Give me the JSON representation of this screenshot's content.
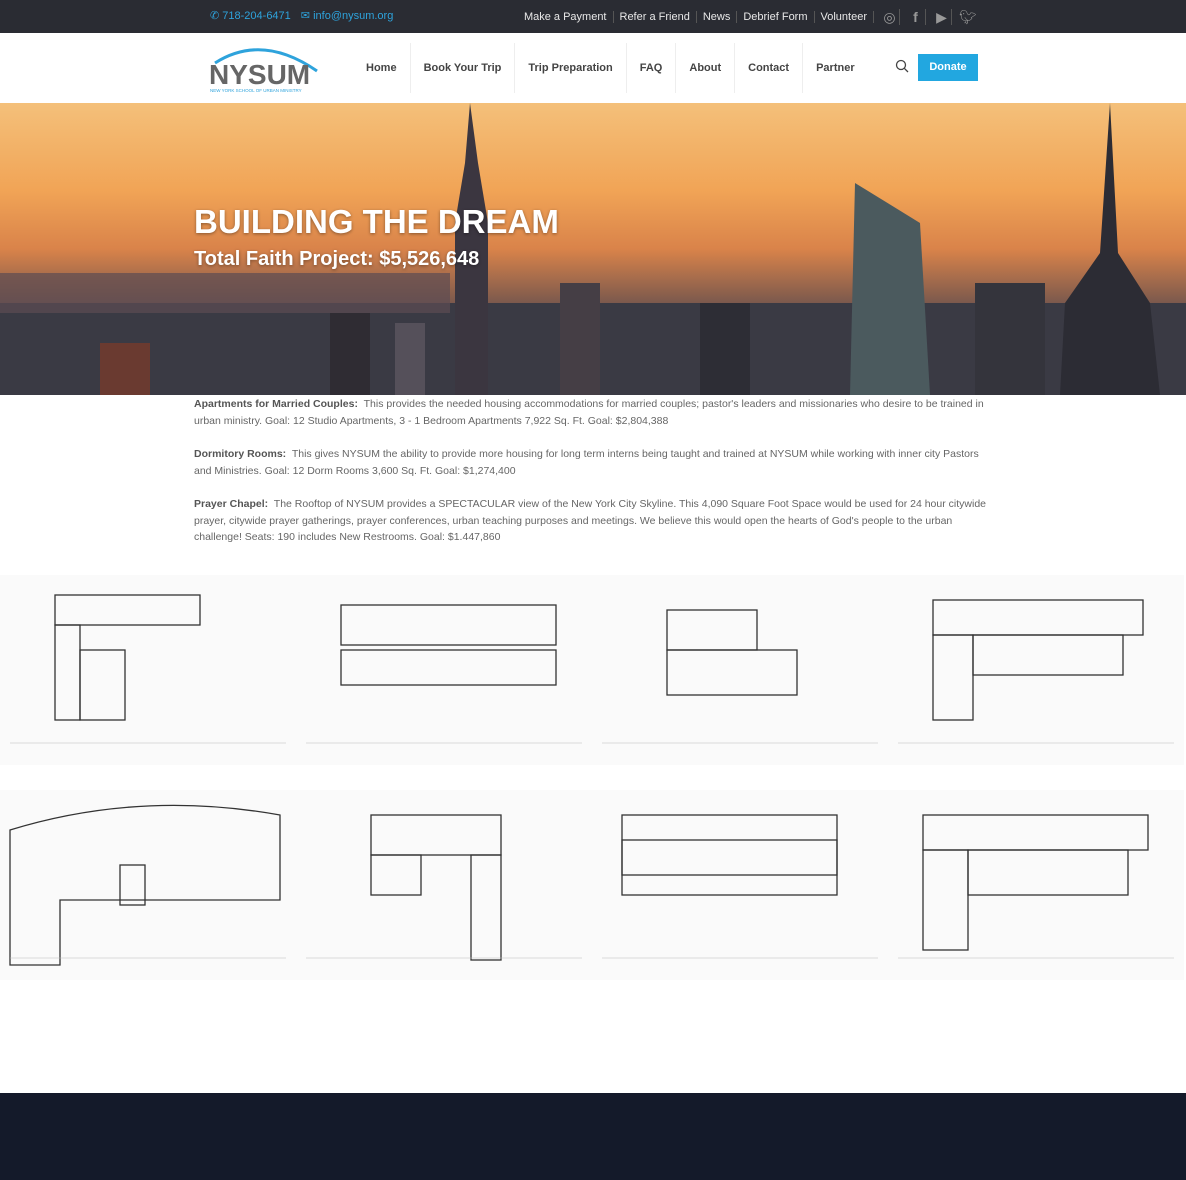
{
  "topbar": {
    "phone": "718-204-6471",
    "email": "info@nysum.org",
    "links": [
      "Make a Payment",
      "Refer a Friend",
      "News",
      "Debrief Form",
      "Volunteer"
    ],
    "social": [
      "instagram-icon",
      "facebook-icon",
      "youtube-icon",
      "twitter-icon"
    ]
  },
  "header": {
    "logo_text": "NYSUM",
    "logo_subtitle": "NEW YORK SCHOOL OF URBAN MINISTRY",
    "nav": [
      "Home",
      "Book Your Trip",
      "Trip Preparation",
      "FAQ",
      "About",
      "Contact",
      "Partner"
    ],
    "donate_label": "Donate"
  },
  "hero": {
    "title": "BUILDING THE DREAM",
    "subtitle": "Total Faith Project: $5,526,648"
  },
  "sections": [
    {
      "heading": "Apartments for Married Couples:",
      "body": "This provides the needed housing accommodations for married couples; pastor's leaders and missionaries who desire to be trained in urban ministry.  Goal: 12 Studio Apartments, 3 - 1 Bedroom Apartments 7,922 Sq. Ft.  Goal: $2,804,388"
    },
    {
      "heading": "Dormitory Rooms:",
      "body": "This gives NYSUM the ability to provide more housing for long term interns being taught and trained at NYSUM while working with inner city Pastors and Ministries. Goal:  12 Dorm Rooms 3,600 Sq. Ft. Goal: $1,274,400"
    },
    {
      "heading": "Prayer Chapel:",
      "body": "The Rooftop of NYSUM provides a SPECTACULAR view of the New York City Skyline.  This 4,090 Square Foot Space would be used for 24 hour citywide prayer, citywide prayer gatherings, prayer conferences, urban teaching purposes and meetings.  We believe this would open the hearts of God's people to the urban challenge! Seats: 190 includes New Restrooms. Goal:  $1.447,860"
    }
  ],
  "colors": {
    "accent": "#22a7e0",
    "topbar": "#2a2c33",
    "footer": "#141a2a"
  }
}
